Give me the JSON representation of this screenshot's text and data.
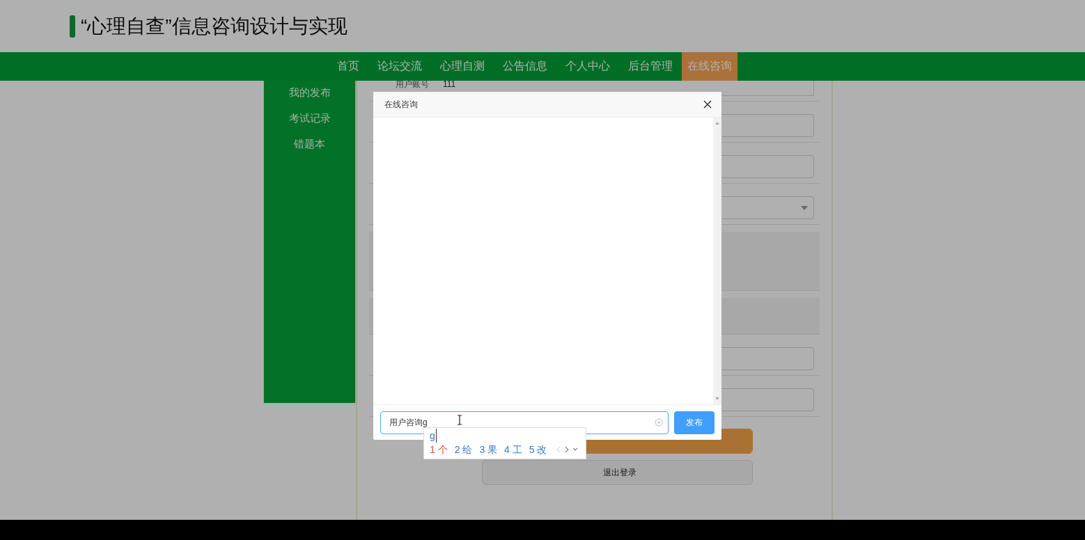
{
  "header": {
    "title": "“心理自查”信息咨询设计与实现"
  },
  "nav": [
    {
      "label": "首页",
      "selected": false
    },
    {
      "label": "论坛交流",
      "selected": false
    },
    {
      "label": "心理自测",
      "selected": false
    },
    {
      "label": "公告信息",
      "selected": false
    },
    {
      "label": "个人中心",
      "selected": false
    },
    {
      "label": "后台管理",
      "selected": false
    },
    {
      "label": "在线咨询",
      "selected": true
    }
  ],
  "sidebar": {
    "items": [
      {
        "label": "我的发布"
      },
      {
        "label": "考试记录"
      },
      {
        "label": "错题本"
      }
    ]
  },
  "form": {
    "rows": [
      {
        "kind": "input",
        "label": "用户账号",
        "value": "111"
      },
      {
        "kind": "input"
      },
      {
        "kind": "input"
      },
      {
        "kind": "select"
      },
      {
        "kind": "area"
      },
      {
        "kind": "panel"
      },
      {
        "kind": "input"
      },
      {
        "kind": "input"
      }
    ]
  },
  "buttons": [
    {
      "kind": "primary"
    },
    {
      "kind": "default",
      "label": "退出登录"
    }
  ],
  "dialog": {
    "title": "在线咨询",
    "input_value": "用户咨询g",
    "send_button": "发布"
  },
  "ime": {
    "composition": "g",
    "candidates": [
      {
        "index": "1",
        "text": "个",
        "selected": true
      },
      {
        "index": "2",
        "text": "给",
        "selected": false
      },
      {
        "index": "3",
        "text": "果",
        "selected": false
      },
      {
        "index": "4",
        "text": "工",
        "selected": false
      },
      {
        "index": "5",
        "text": "改",
        "selected": false
      }
    ]
  }
}
